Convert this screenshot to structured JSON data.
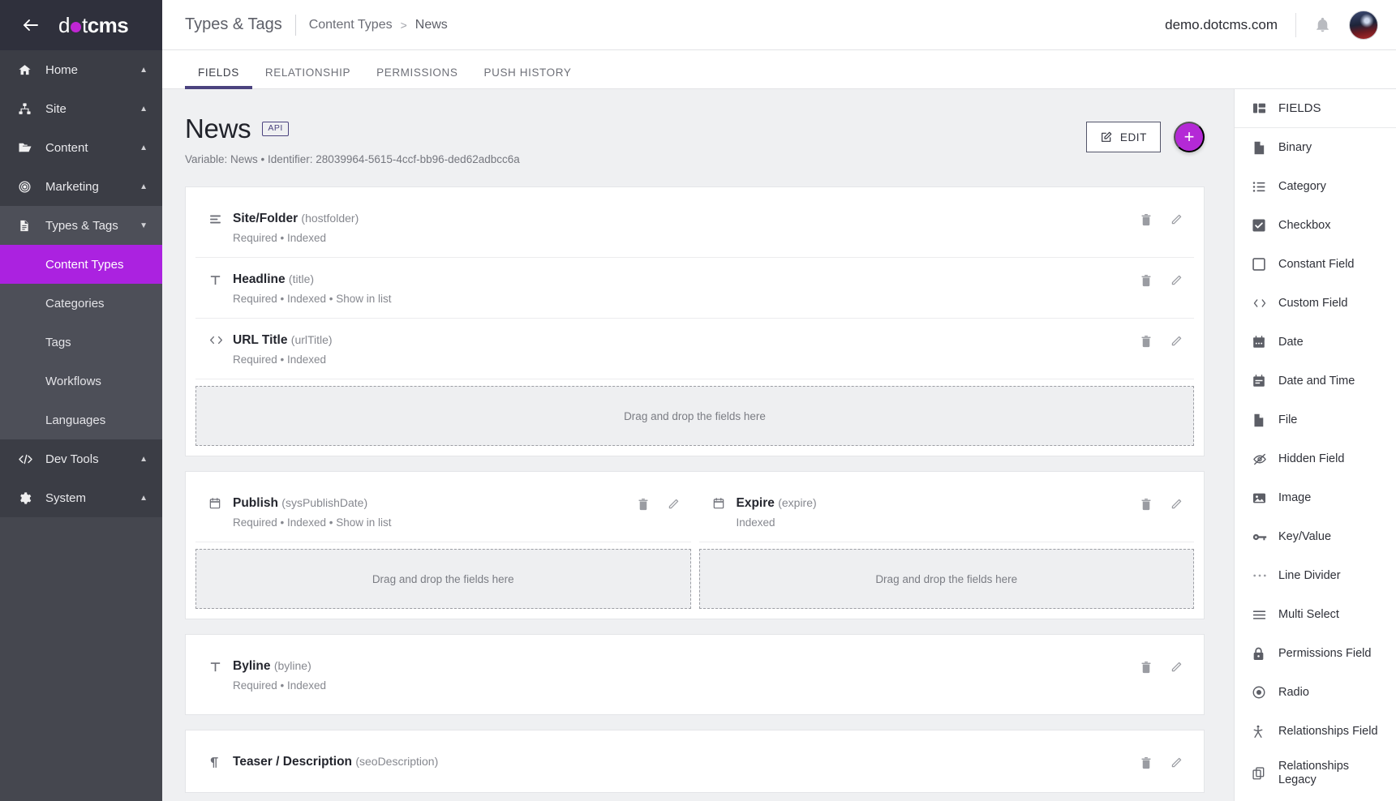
{
  "sidebar": {
    "logo": {
      "light": "d",
      "dot": "dot-icon",
      "bold": "cms"
    },
    "back_icon": "back-arrow-icon",
    "items": [
      {
        "label": "Home",
        "icon": "home-icon",
        "chevron": "chevron-up-icon"
      },
      {
        "label": "Site",
        "icon": "sitemap-icon",
        "chevron": "chevron-up-icon"
      },
      {
        "label": "Content",
        "icon": "folder-icon",
        "chevron": "chevron-up-icon"
      },
      {
        "label": "Marketing",
        "icon": "target-icon",
        "chevron": "chevron-up-icon"
      },
      {
        "label": "Types & Tags",
        "icon": "document-icon",
        "chevron": "chevron-down-icon"
      }
    ],
    "sub_items": [
      {
        "label": "Content Types",
        "active": true
      },
      {
        "label": "Categories",
        "active": false
      },
      {
        "label": "Tags",
        "active": false
      },
      {
        "label": "Workflows",
        "active": false
      },
      {
        "label": "Languages",
        "active": false
      }
    ],
    "items_after": [
      {
        "label": "Dev Tools",
        "icon": "code-icon",
        "chevron": "chevron-up-icon"
      },
      {
        "label": "System",
        "icon": "gear-icon",
        "chevron": "chevron-up-icon"
      }
    ],
    "active_color": "#ab22e0"
  },
  "topbar": {
    "breadcrumb": {
      "root": "Types & Tags",
      "middle": "Content Types",
      "separator": ">",
      "leaf": "News"
    },
    "host": "demo.dotcms.com",
    "bell_icon": "notification-bell-icon",
    "avatar": "user-avatar"
  },
  "tabs": [
    {
      "label": "FIELDS",
      "active": true
    },
    {
      "label": "RELATIONSHIP",
      "active": false
    },
    {
      "label": "PERMISSIONS",
      "active": false
    },
    {
      "label": "PUSH HISTORY",
      "active": false
    }
  ],
  "page": {
    "title": "News",
    "api_badge": "API",
    "meta": "Variable: News • Identifier: 28039964-5615-4ccf-bb96-ded62adbcc6a",
    "edit_label": "EDIT",
    "edit_icon": "pencil-square-icon",
    "add_label": "+",
    "accent_color": "#b429d6",
    "tab_underline_color": "#4b437f"
  },
  "dropzone_text": "Drag and drop the fields here",
  "row_actions": {
    "delete_icon": "trash-icon",
    "edit_icon": "pencil-icon"
  },
  "rows": [
    {
      "layout": "single",
      "columns": [
        {
          "fields": [
            {
              "name": "Site/Folder",
              "variable": "(hostfolder)",
              "meta": "Required • Indexed",
              "icon": "list-lines-icon"
            },
            {
              "name": "Headline",
              "variable": "(title)",
              "meta": "Required • Indexed • Show in list",
              "icon": "text-T-icon"
            },
            {
              "name": "URL Title",
              "variable": "(urlTitle)",
              "meta": "Required • Indexed",
              "icon": "code-brackets-icon"
            }
          ],
          "dropzone": true
        }
      ]
    },
    {
      "layout": "double",
      "columns": [
        {
          "fields": [
            {
              "name": "Publish",
              "variable": "(sysPublishDate)",
              "meta": "Required • Indexed • Show in list",
              "icon": "calendar-icon"
            }
          ],
          "dropzone": true
        },
        {
          "fields": [
            {
              "name": "Expire",
              "variable": "(expire)",
              "meta": "Indexed",
              "icon": "calendar-icon"
            }
          ],
          "dropzone": true
        }
      ]
    },
    {
      "layout": "single",
      "columns": [
        {
          "fields": [
            {
              "name": "Byline",
              "variable": "(byline)",
              "meta": "Required • Indexed",
              "icon": "text-T-icon"
            }
          ],
          "dropzone": false
        }
      ]
    },
    {
      "layout": "single",
      "columns": [
        {
          "fields": [
            {
              "name": "Teaser / Description",
              "variable": "(seoDescription)",
              "meta": "",
              "icon": "paragraph-icon"
            }
          ],
          "dropzone": false
        }
      ]
    }
  ],
  "fields_panel": {
    "header": {
      "label": "FIELDS",
      "icon": "layout-grid-icon"
    },
    "items": [
      {
        "label": "Binary",
        "icon": "file-binary-icon"
      },
      {
        "label": "Category",
        "icon": "bullet-list-icon"
      },
      {
        "label": "Checkbox",
        "icon": "checkbox-checked-icon"
      },
      {
        "label": "Constant Field",
        "icon": "square-outline-icon"
      },
      {
        "label": "Custom Field",
        "icon": "code-brackets-icon"
      },
      {
        "label": "Date",
        "icon": "calendar-icon"
      },
      {
        "label": "Date and Time",
        "icon": "calendar-clock-icon"
      },
      {
        "label": "File",
        "icon": "file-icon"
      },
      {
        "label": "Hidden Field",
        "icon": "eye-off-icon"
      },
      {
        "label": "Image",
        "icon": "image-icon"
      },
      {
        "label": "Key/Value",
        "icon": "key-icon"
      },
      {
        "label": "Line Divider",
        "icon": "ellipsis-icon"
      },
      {
        "label": "Multi Select",
        "icon": "menu-lines-icon"
      },
      {
        "label": "Permissions Field",
        "icon": "lock-icon"
      },
      {
        "label": "Radio",
        "icon": "radio-button-icon"
      },
      {
        "label": "Relationships Field",
        "icon": "person-relation-icon"
      },
      {
        "label": "Relationships Legacy",
        "icon": "copy-stack-icon"
      }
    ]
  }
}
